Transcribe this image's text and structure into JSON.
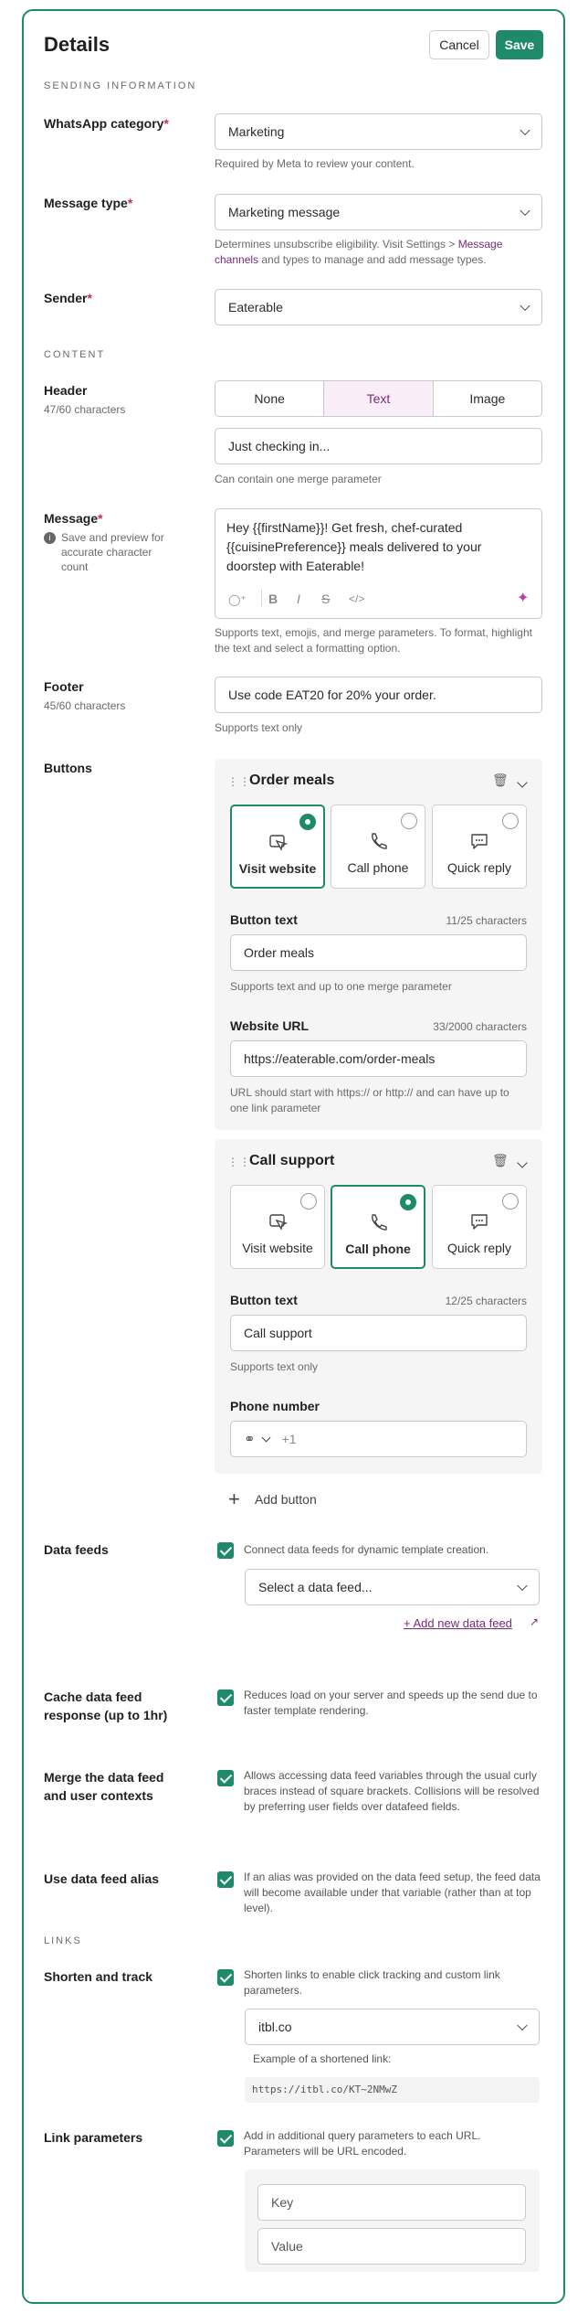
{
  "header": {
    "title": "Details",
    "cancel": "Cancel",
    "save": "Save"
  },
  "sections": {
    "sending": "SENDING INFORMATION",
    "content": "CONTENT",
    "links": "LINKS"
  },
  "whatsapp_category": {
    "label": "WhatsApp category",
    "value": "Marketing",
    "help": "Required by Meta to review your content."
  },
  "message_type": {
    "label": "Message type",
    "value": "Marketing message",
    "help_pre": "Determines unsubscribe eligibility. Visit Settings > ",
    "help_link": "Message channels",
    "help_post": " and types to manage and add message types."
  },
  "sender": {
    "label": "Sender",
    "value": "Eaterable"
  },
  "header_field": {
    "label": "Header",
    "count": "47/60 characters",
    "options": [
      "None",
      "Text",
      "Image"
    ],
    "selected": "Text",
    "value": "Just checking in...",
    "help": "Can contain one merge parameter"
  },
  "message": {
    "label": "Message",
    "note": "Save and preview for accurate character count",
    "body": "Hey {{firstName}}! Get fresh, chef-curated {{cuisinePreference}} meals delivered to your doorstep with Eaterable!",
    "help": "Supports text, emojis, and merge parameters. To format, highlight the text and select a formatting option."
  },
  "footer": {
    "label": "Footer",
    "count": "45/60 characters",
    "value": "Use code EAT20 for 20% your order.",
    "help": "Supports text only"
  },
  "buttons": {
    "label": "Buttons",
    "option_labels": [
      "Visit website",
      "Call phone",
      "Quick reply"
    ],
    "items": [
      {
        "title": "Order meals",
        "selected": "Visit website",
        "text_label": "Button text",
        "text_count": "11/25 characters",
        "text_value": "Order meals",
        "text_help": "Supports text and up to one merge parameter",
        "extra_label": "Website URL",
        "extra_count": "33/2000 characters",
        "extra_value": "https://eaterable.com/order-meals",
        "extra_help": "URL should start with https:// or http:// and can have up to one link parameter"
      },
      {
        "title": "Call support",
        "selected": "Call phone",
        "text_label": "Button text",
        "text_count": "12/25 characters",
        "text_value": "Call support",
        "text_help": "Supports text only",
        "extra_label": "Phone number",
        "extra_value": "+1"
      }
    ],
    "add": "Add button"
  },
  "data_feeds": {
    "label": "Data feeds",
    "checkbox": "Connect data feeds for dynamic template creation.",
    "select_placeholder": "Select a data feed...",
    "add_link": "+ Add new data feed"
  },
  "cache": {
    "label": "Cache data feed response (up to 1hr)",
    "checkbox": "Reduces load on your server and speeds up the send due to faster template rendering."
  },
  "merge": {
    "label": "Merge the data feed and user contexts",
    "checkbox": "Allows accessing data feed variables through the usual curly braces instead of square brackets. Collisions will be resolved by preferring user fields over datafeed fields."
  },
  "alias": {
    "label": "Use data feed alias",
    "checkbox": "If an alias was provided on the data feed setup, the feed data will become available under that variable (rather than at top level)."
  },
  "shorten": {
    "label": "Shorten and track",
    "checkbox": "Shorten links to enable click tracking and custom link parameters.",
    "domain": "itbl.co",
    "example_label": "Example of a shortened link:",
    "example": "https://itbl.co/KT~2NMwZ"
  },
  "link_params": {
    "label": "Link parameters",
    "checkbox": "Add in additional query parameters to each URL. Parameters will be URL encoded.",
    "key_placeholder": "Key",
    "value_placeholder": "Value"
  },
  "colors": {
    "accent": "#1e8a6a",
    "link": "#7a2a7a",
    "required": "#c4304f"
  }
}
